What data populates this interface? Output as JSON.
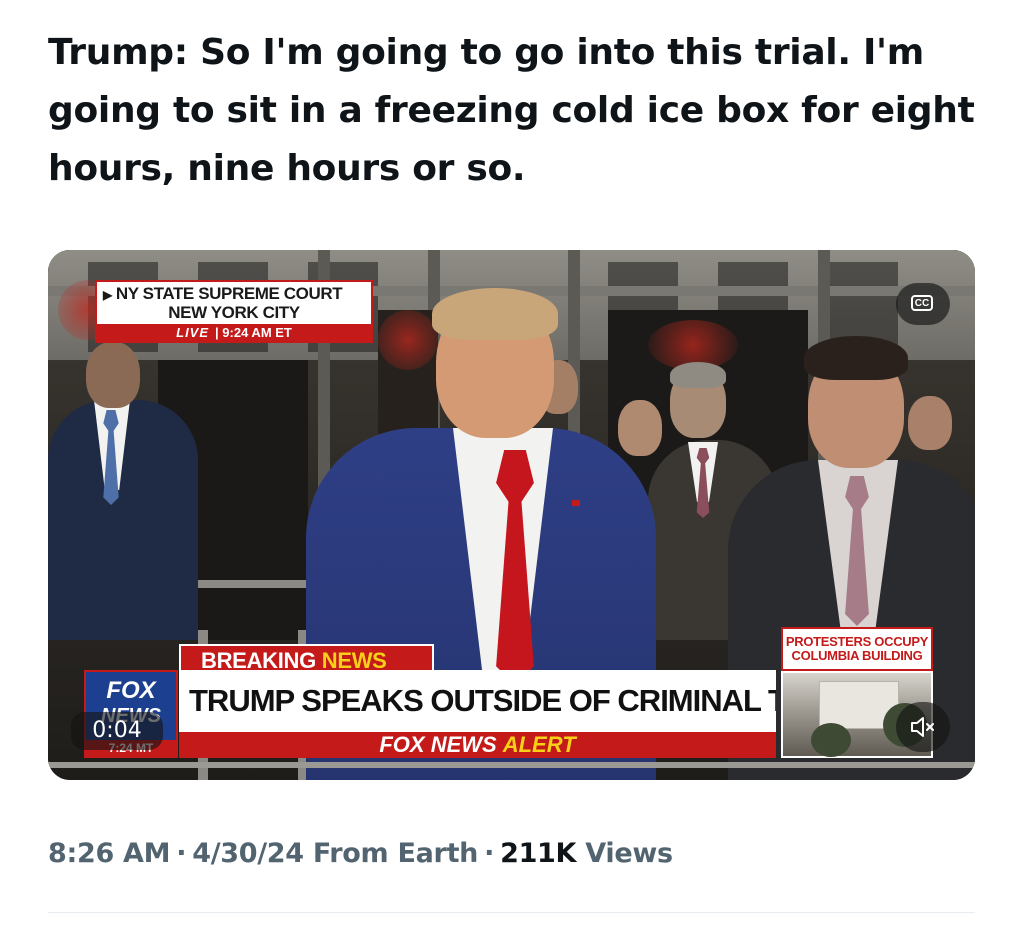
{
  "tweet": {
    "text": "Trump: So I'm going to go into this trial. I'm going to sit in a freezing cold ice box for eight hours, nine hours or so."
  },
  "video": {
    "locator": {
      "line1": "NY STATE SUPREME COURT",
      "line2": "NEW YORK CITY",
      "live_label": "LIVE",
      "live_time": "| 9:24 AM ET"
    },
    "breaking": {
      "part1": "BREAKING",
      "part2": "NEWS"
    },
    "headline": "TRUMP SPEAKS OUTSIDE OF CRIMINAL TRIAL",
    "ticker": {
      "part1": "FOX NEWS",
      "part2": "ALERT"
    },
    "fox_logo": {
      "line1": "FOX",
      "line2": "NEWS",
      "time": "7:24 MT"
    },
    "side_box": {
      "line1": "PROTESTERS OCCUPY",
      "line2": "COLUMBIA BUILDING"
    },
    "elapsed": "0:04",
    "cc_label": "CC",
    "icons": [
      "closed-captions-icon",
      "mute-icon"
    ]
  },
  "meta": {
    "time": "8:26 AM",
    "date": "4/30/24",
    "source": "From Earth",
    "views_count": "211K",
    "views_label": "Views"
  }
}
